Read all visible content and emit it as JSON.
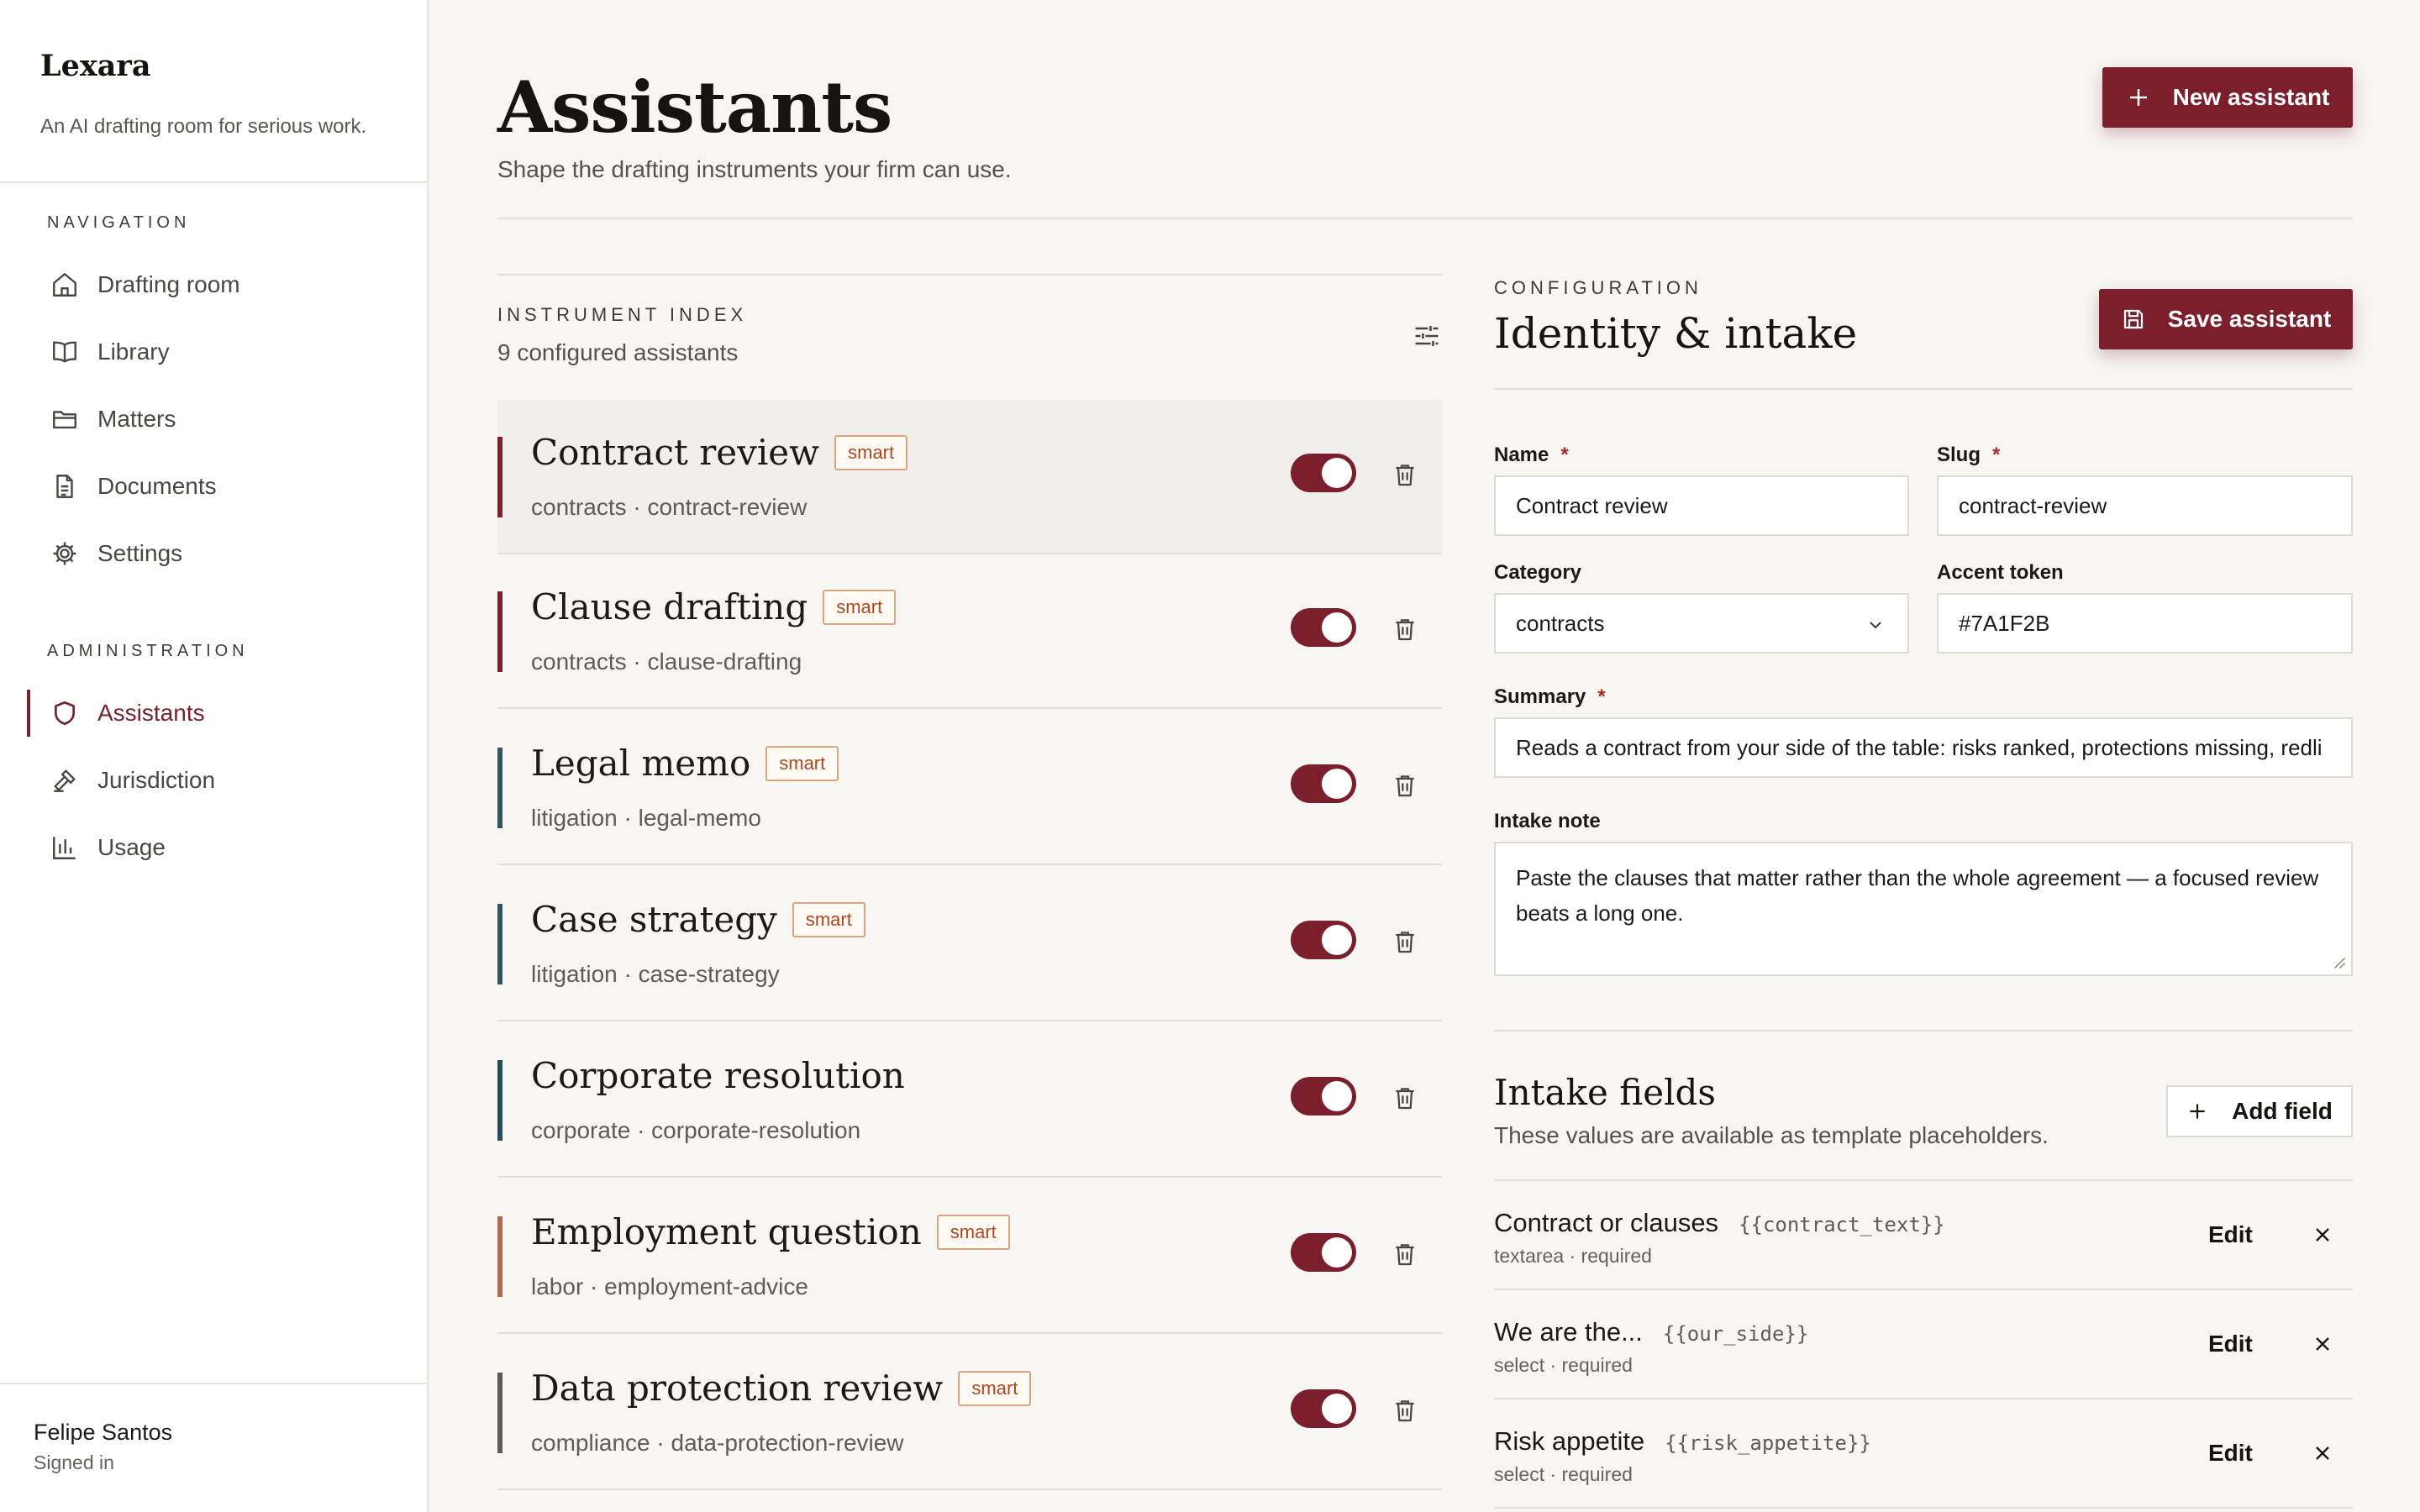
{
  "sidebar": {
    "brand": "Lexara",
    "tagline": "An AI drafting room for serious work.",
    "nav_label": "NAVIGATION",
    "nav": [
      {
        "label": "Drafting room",
        "icon": "home-icon"
      },
      {
        "label": "Library",
        "icon": "book-icon"
      },
      {
        "label": "Matters",
        "icon": "folder-icon"
      },
      {
        "label": "Documents",
        "icon": "document-icon"
      },
      {
        "label": "Settings",
        "icon": "gear-icon"
      }
    ],
    "admin_label": "ADMINISTRATION",
    "admin": [
      {
        "label": "Assistants",
        "icon": "shield-icon",
        "active": true
      },
      {
        "label": "Jurisdiction",
        "icon": "gavel-icon"
      },
      {
        "label": "Usage",
        "icon": "bar-chart-icon"
      }
    ],
    "user": {
      "name": "Felipe Santos",
      "status": "Signed in"
    }
  },
  "header": {
    "title": "Assistants",
    "subtitle": "Shape the drafting instruments your firm can use.",
    "new_button": "New assistant"
  },
  "list": {
    "eyebrow": "INSTRUMENT INDEX",
    "count": "9 configured assistants",
    "items": [
      {
        "name": "Contract review",
        "badge": "smart",
        "meta": "contracts · contract-review",
        "accent": "#7a1f2b",
        "enabled": true
      },
      {
        "name": "Clause drafting",
        "badge": "smart",
        "meta": "contracts · clause-drafting",
        "accent": "#7a1f2b",
        "enabled": true
      },
      {
        "name": "Legal memo",
        "badge": "smart",
        "meta": "litigation · legal-memo",
        "accent": "#2f5560",
        "enabled": true
      },
      {
        "name": "Case strategy",
        "badge": "smart",
        "meta": "litigation · case-strategy",
        "accent": "#2f5560",
        "enabled": true
      },
      {
        "name": "Corporate resolution",
        "badge": "",
        "meta": "corporate · corporate-resolution",
        "accent": "#234f5c",
        "enabled": true
      },
      {
        "name": "Employment question",
        "badge": "smart",
        "meta": "labor · employment-advice",
        "accent": "#b06a52",
        "enabled": true
      },
      {
        "name": "Data protection review",
        "badge": "smart",
        "meta": "compliance · data-protection-review",
        "accent": "#5c5a57",
        "enabled": true
      }
    ]
  },
  "config": {
    "eyebrow": "CONFIGURATION",
    "title": "Identity & intake",
    "save_button": "Save assistant",
    "name_label": "Name",
    "name_value": "Contract review",
    "slug_label": "Slug",
    "slug_value": "contract-review",
    "category_label": "Category",
    "category_value": "contracts",
    "accent_label": "Accent token",
    "accent_value": "#7A1F2B",
    "summary_label": "Summary",
    "summary_value": "Reads a contract from your side of the table: risks ranked, protections missing, redli",
    "intake_note_label": "Intake note",
    "intake_note_value": "Paste the clauses that matter rather than the whole agreement — a focused review beats a long one.",
    "required_mark": "*"
  },
  "intake": {
    "title": "Intake fields",
    "subtitle": "These values are available as template placeholders.",
    "add_button": "Add field",
    "edit_label": "Edit",
    "fields": [
      {
        "label": "Contract or clauses",
        "token": "{{contract_text}}",
        "meta": "textarea · required"
      },
      {
        "label": "We are the...",
        "token": "{{our_side}}",
        "meta": "select · required"
      },
      {
        "label": "Risk appetite",
        "token": "{{risk_appetite}}",
        "meta": "select · required"
      }
    ]
  },
  "colors": {
    "accent": "#7a1f2b",
    "background": "#f7f6f3",
    "badge": "#b0451e"
  }
}
